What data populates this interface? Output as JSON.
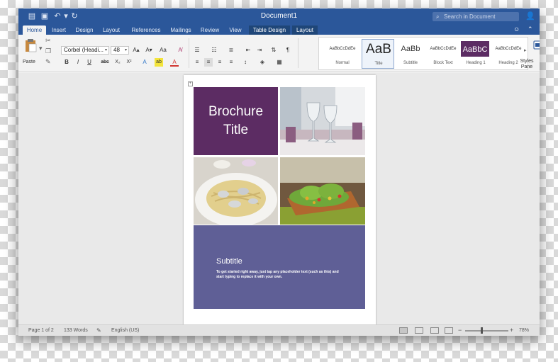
{
  "titlebar": {
    "title": "Document1",
    "search_placeholder": "Search in Document"
  },
  "tabs": [
    {
      "label": "Home"
    },
    {
      "label": "Insert"
    },
    {
      "label": "Design"
    },
    {
      "label": "Layout"
    },
    {
      "label": "References"
    },
    {
      "label": "Mailings"
    },
    {
      "label": "Review"
    },
    {
      "label": "View"
    },
    {
      "label": "Table Design"
    },
    {
      "label": "Layout"
    }
  ],
  "ribbon": {
    "paste_label": "Paste",
    "font_name": "Corbel (Headi...",
    "font_size": "48",
    "bold": "B",
    "italic": "I",
    "underline": "U",
    "strikethrough": "abc",
    "subscript": "X₂",
    "superscript": "X²",
    "grow_font": "A▴",
    "shrink_font": "A▾",
    "change_case": "Aa",
    "text_effects": "A",
    "highlight": "ab",
    "font_color": "A",
    "styles": [
      {
        "preview": "AaBbCcDdEe",
        "label": "Normal"
      },
      {
        "preview": "AaB",
        "label": "Title"
      },
      {
        "preview": "AaBb",
        "label": "Subtitle"
      },
      {
        "preview": "AaBbCcDdEe",
        "label": "Block Text"
      },
      {
        "preview": "AaBbC",
        "label": "Heading 1"
      },
      {
        "preview": "AaBbCcDdEe",
        "label": "Heading 2"
      }
    ],
    "styles_pane_label": "Styles Pane"
  },
  "document": {
    "title": "Brochure Title",
    "subtitle": "Subtitle",
    "subtitle_body": "To get started right away, just tap any placeholder text (such as this) and start typing to replace it with your own."
  },
  "status": {
    "page": "Page 1 of 2",
    "words": "133 Words",
    "language": "English (US)",
    "zoom": "78%",
    "zoom_fraction": 0.78
  },
  "colors": {
    "ribbon_blue": "#2b579a",
    "title_purple": "#5c2c63",
    "subtitle_blue": "#5f5f96"
  }
}
